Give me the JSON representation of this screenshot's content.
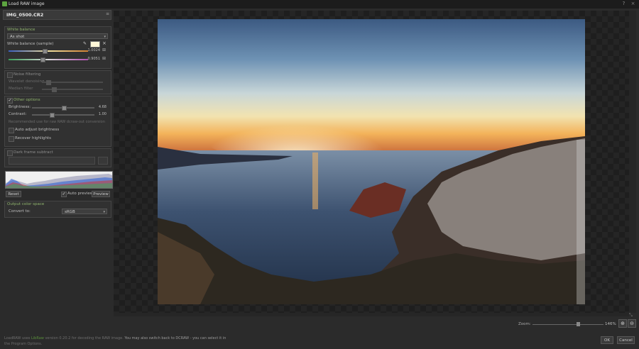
{
  "window": {
    "title": "Load RAW image"
  },
  "file": {
    "name": "IMG_0500.CR2",
    "collapse_icon": "≡"
  },
  "white_balance": {
    "title": "White balance",
    "preset": "As shot",
    "sample_label": "White balance (sample)",
    "slider1_value": "1.0024",
    "slider1_fraction": 0.45,
    "slider2_value": "0.9051",
    "slider2_fraction": 0.42
  },
  "noise": {
    "title": "Noise filtering",
    "wavelet_label": "Wavelet denoising",
    "median_label": "Median filter"
  },
  "other": {
    "title": "Other options",
    "brightness_label": "Brightness:",
    "brightness_value": "4.68",
    "brightness_fraction": 0.5,
    "contrast_label": "Contrast:",
    "contrast_value": "1.00",
    "contrast_fraction": 0.3,
    "hint": "Recommended use for raw RAW dcraw-out conversion",
    "auto_brightness": "Auto adjust brightness",
    "recover_highlights": "Recover highlights"
  },
  "dark_frame": {
    "title": "Dark frame subtract"
  },
  "buttons": {
    "reset": "Reset",
    "auto_preview": "Auto preview",
    "preview": "Preview",
    "ok": "OK",
    "cancel": "Cancel"
  },
  "output": {
    "title": "Output color space",
    "convert_label": "Convert to:",
    "convert_value": "sRGB"
  },
  "zoom": {
    "label": "Zoom:",
    "value": "146%"
  },
  "footer": {
    "prefix": "LoadRAW uses ",
    "link": "LibRaw",
    "middle": " version 0.20.2 for decoding the RAW image. ",
    "highlight": "You may also switch back to DCRAW - you can select it in",
    "line2": "the Program Options."
  }
}
